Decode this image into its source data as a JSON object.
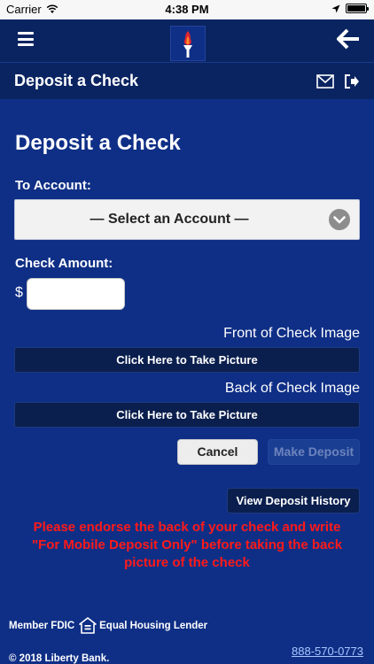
{
  "status_bar": {
    "carrier": "Carrier",
    "time": "4:38 PM",
    "battery_level": 1.0
  },
  "header": {
    "menu_icon": "hamburger-menu-icon",
    "logo_icon": "torch-logo-icon",
    "back_icon": "back-arrow-icon"
  },
  "title_bar": {
    "title": "Deposit a Check",
    "mail_icon": "envelope-icon",
    "logout_icon": "logout-icon"
  },
  "form": {
    "heading": "Deposit a Check",
    "to_account_label": "To Account:",
    "account_select_value": "— Select an Account —",
    "check_amount_label": "Check Amount:",
    "currency_symbol": "$",
    "amount_value": "",
    "front_image_label": "Front of Check Image",
    "front_picture_button": "Click Here to Take Picture",
    "back_image_label": "Back of Check Image",
    "back_picture_button": "Click Here to Take Picture",
    "cancel_button": "Cancel",
    "make_deposit_button": "Make Deposit",
    "view_history_button": "View Deposit History",
    "warning_line1": "Please endorse the back of your check and write",
    "warning_line2": "\"For Mobile Deposit Only\" before taking the back",
    "warning_line3": "picture of the check"
  },
  "footer": {
    "member_fdic": "Member FDIC",
    "equal_housing": "Equal Housing Lender",
    "equal_housing_icon": "equal-housing-lender-icon",
    "copyright": "© 2018 Liberty Bank.",
    "phone": "888-570-0773"
  },
  "colors": {
    "background": "#0f2f86",
    "header": "#0a2461",
    "warning": "#ff1a1a",
    "link": "#a7c6ff"
  }
}
